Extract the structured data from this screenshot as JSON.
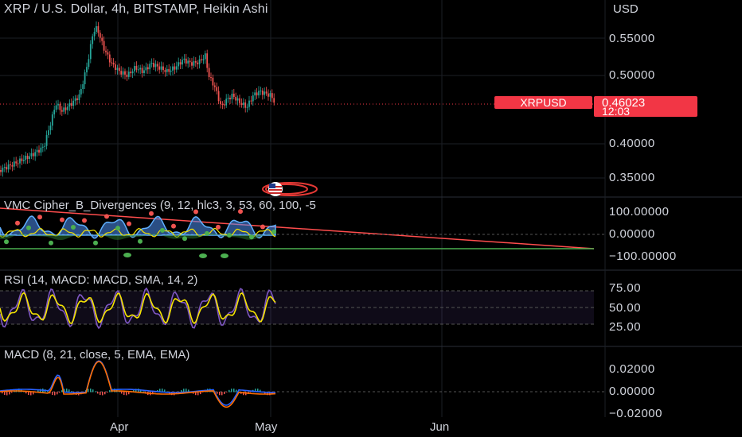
{
  "header": {
    "title": "XRP / U.S. Dollar, 4h, BITSTAMP, Heikin Ashi",
    "currency": "USD"
  },
  "price_axis": {
    "labels": [
      "0.55000",
      "0.50000",
      "0.40000",
      "0.35000"
    ]
  },
  "last_price": {
    "symbol": "XRPUSD",
    "price": "0.46023",
    "countdown": "12:03"
  },
  "indicators": {
    "vmc": {
      "title": "VMC Cipher_B_Divergences (9, 12, hlc3, 3, 53, 60, 100, -5",
      "axis": [
        "100.00000",
        "0.00000",
        "−100.00000"
      ]
    },
    "rsi": {
      "title": "RSI (14, MACD: MACD, SMA, 14, 2)",
      "axis": [
        "75.00",
        "50.00",
        "25.00"
      ]
    },
    "macd": {
      "title": "MACD (8, 21, close, 5, EMA, EMA)",
      "axis": [
        "0.02000",
        "0.00000",
        "−0.02000"
      ]
    }
  },
  "time_axis": {
    "labels": [
      "Apr",
      "May",
      "Jun"
    ]
  },
  "colors": {
    "background": "#000000",
    "up": "#26a69a",
    "down": "#ef5350",
    "badge": "#f23645",
    "rsi_line": "#7e57c2",
    "rsi_signal": "#f5e400",
    "macd_line": "#2962ff",
    "signal_line": "#ff6d00"
  }
}
